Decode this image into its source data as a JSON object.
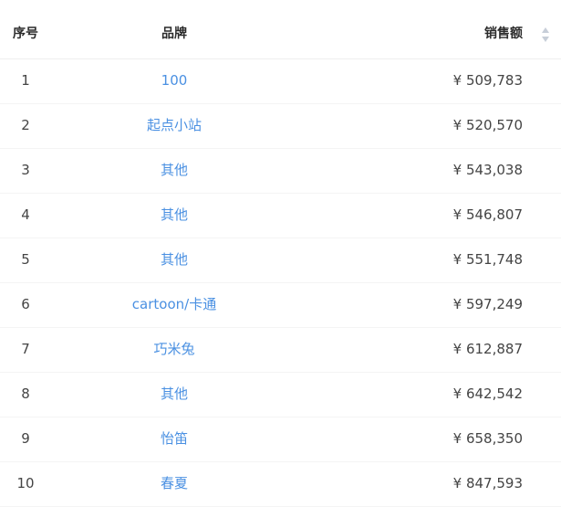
{
  "header": {
    "index_label": "序号",
    "brand_label": "品牌",
    "sales_label": "销售额",
    "sort_icon": "sort-arrows-icon"
  },
  "rows": [
    {
      "index": "1",
      "brand": "100",
      "sales": "¥ 509,783"
    },
    {
      "index": "2",
      "brand": "起点小站",
      "sales": "¥ 520,570"
    },
    {
      "index": "3",
      "brand": "其他",
      "sales": "¥ 543,038"
    },
    {
      "index": "4",
      "brand": "其他",
      "sales": "¥ 546,807"
    },
    {
      "index": "5",
      "brand": "其他",
      "sales": "¥ 551,748"
    },
    {
      "index": "6",
      "brand": "cartoon/卡通",
      "sales": "¥ 597,249"
    },
    {
      "index": "7",
      "brand": "巧米兔",
      "sales": "¥ 612,887"
    },
    {
      "index": "8",
      "brand": "其他",
      "sales": "¥ 642,542"
    },
    {
      "index": "9",
      "brand": "怡笛",
      "sales": "¥ 658,350"
    },
    {
      "index": "10",
      "brand": "春夏",
      "sales": "¥ 847,593"
    }
  ]
}
